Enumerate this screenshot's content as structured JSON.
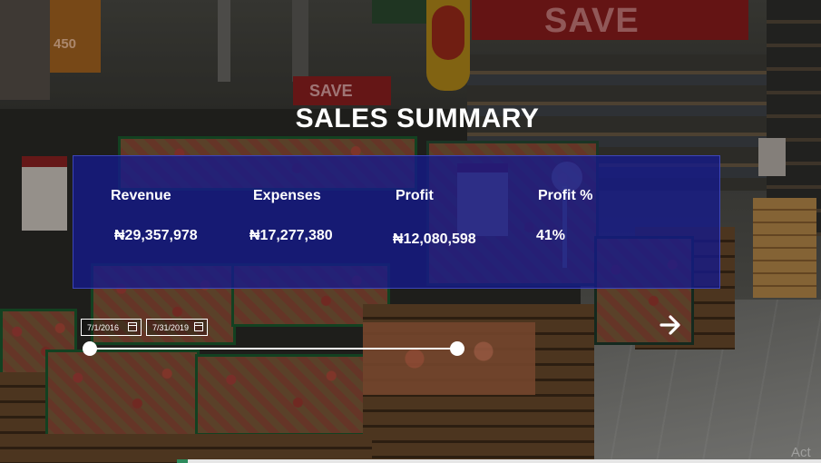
{
  "title": "SALES SUMMARY",
  "kpis": [
    {
      "label": "Revenue",
      "value": "₦29,357,978"
    },
    {
      "label": "Expenses",
      "value": "₦17,277,380"
    },
    {
      "label": "Profit",
      "value": "₦12,080,598"
    },
    {
      "label": "Profit %",
      "value": "41%"
    }
  ],
  "date_filter": {
    "start": "7/1/2016",
    "end": "7/31/2019"
  },
  "background_signs": {
    "save_top": "SAVE",
    "save_left": "SAVE",
    "poster": "450"
  },
  "watermark": "Act",
  "icons": {
    "calendar": "calendar-icon",
    "next": "arrow-right-icon"
  },
  "colors": {
    "panel": "#14198C",
    "text": "#FFFFFF",
    "accent_bar": "#2D8A5C"
  }
}
